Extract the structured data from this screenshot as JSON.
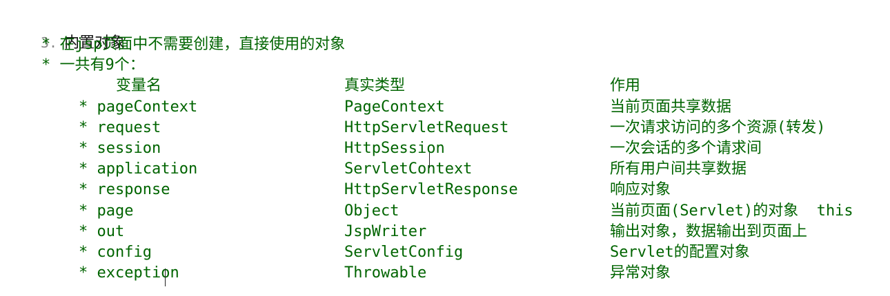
{
  "heading": {
    "number": "3.",
    "title": "内置对象"
  },
  "points": [
    "* 在jsp页面中不需要创建，直接使用的对象",
    "* 一共有9个："
  ],
  "columns": [
    "变量名",
    "真实类型",
    "作用"
  ],
  "rows": [
    {
      "name": "* pageContext",
      "type": "PageContext",
      "purpose": "当前页面共享数据"
    },
    {
      "name": "* request",
      "type": "HttpServletRequest",
      "purpose": "一次请求访问的多个资源(转发)"
    },
    {
      "name": "* session",
      "type": "HttpSession",
      "purpose": "一次会话的多个请求间"
    },
    {
      "name": "* application",
      "type": "ServletContext",
      "purpose": "所有用户间共享数据"
    },
    {
      "name": "* response",
      "type": "HttpServletResponse",
      "purpose": "响应对象"
    },
    {
      "name": "* page",
      "type": "Object",
      "purpose": "当前页面(Servlet)的对象  this"
    },
    {
      "name": "* out",
      "type": "JspWriter",
      "purpose": "输出对象，数据输出到页面上"
    },
    {
      "name": "* config",
      "type": "ServletConfig",
      "purpose": "Servlet的配置对象"
    },
    {
      "name": "* exception",
      "type": "Throwable",
      "purpose": "异常对象"
    }
  ]
}
